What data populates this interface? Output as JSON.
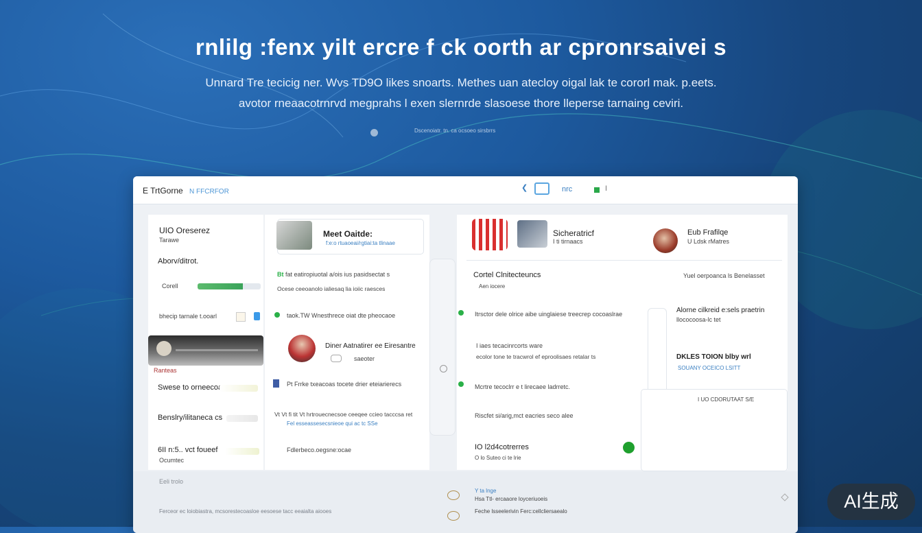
{
  "hero": {
    "title": "rnlilg :fenx yilt ercre f ck oorth ar cpronrsaivei s",
    "subtitle_line1": "Unnard  Tre tecicig ner. Wvs TD9O likes snoarts. Methes uan atecloy oigal lak te cororl mak. p.eets.",
    "subtitle_line2": "avotor rneaacotrnrvd megprahs l exen slernrde slasoese thore lleperse tarnaing ceviri.",
    "caption": "Dscenoiatr. tn. ca ocsoeo sirsbrrs"
  },
  "window": {
    "brand": "E TrtGorne",
    "brand_accent": "N  FFCRFOR",
    "toolbar_label": "nrc",
    "toolbar_marker": "I"
  },
  "left_column": {
    "header": "UIO Oreserez",
    "header_sub": "Tarawe",
    "section_label": "Aborv/ditrot.",
    "progress_label": "Corell",
    "progress_value": 0.72,
    "item1": "bhecip  tarnale  t.ooarl",
    "image_caption": "Ranteas",
    "item2": "Swese to orneecoa",
    "item3": "Benslry/ilitaneca cs",
    "item4_title": "6II n:5..  vct foueef",
    "item4_sub": "Ocumtec"
  },
  "mid_column": {
    "card_title": "Meet Oaitde:",
    "card_sub": "f:e:o rtuaoeai/rgtiai:ta tlinaae",
    "row1_strong": "Bt",
    "row1": "fat eatiropiuotal a/ois ius pasidsectat s",
    "row1_sub": "Ocese ceeoanolo ialiesaq lia ioiic raesces",
    "row2": "taok.TW Wnesthrece oiat dte pheocaoe",
    "person_name": "Diner Aatnatirer ee Eiresantre",
    "person_role": "saeoter",
    "row3": "Pt Frrke  txeacoas  tocete  drier eteiarierecs",
    "row4": "Vt Vt fi tit Vt hrtrouecnecsoe ceeqee ccieo tacccsa ret",
    "row4_sub": "Fel esseassesecsnieoe  qui ac tc  SSe",
    "row5": "Fdlerbeco.oegsne:ocae"
  },
  "right_column": {
    "profile1_name": "Sicheratricf",
    "profile1_sub": "I ti tirnaacs",
    "profile2_name": "Eub Frafilqe",
    "profile2_sub": "U Ldsk rMatres",
    "section_title": "Cortel Clnitecteuncs",
    "section_sub": "Aen iocere",
    "section_right": "Yuel oerpoanca ls Benelasset",
    "row1": "Itrsctor dele olrice aibe uinglaiese treecrep cocoaslrae",
    "row2_title": "I iaes tecacinrcorts ware",
    "row2_sub": "ecolor tone te tracwrol ef eproolisaes retalar ts",
    "row3": "Mcrtre tecoclrr e t lirecaee ladrretc.",
    "row4": "Riscfet si/arig,mct eacries seco alee",
    "row5_title": "IO l2d4cotrerres",
    "row5_sub": "O lo  Suteo ci te lrie",
    "side1_title": "Alorne cilkreid e:sels praetrin",
    "side1_sub": "llococoosa-lc tet",
    "side2_title": "DKLES TOION blby wrl",
    "side2_sub": "SOUANY  OCEICO LSITT",
    "side3": "I UO  CDORUTAAT S/E"
  },
  "footer": {
    "left_label": "Eeli trolo",
    "left_text": "Ferceor ec loiobiastra, mcsorestecoasloe eesoese tacc eeaialta aiooes",
    "right_title": "Y ta lnge",
    "right_sub": "Hsa Ttl- ercaaore loyceriuoeis",
    "right_text": "Feche lsseelerivin  Ferc:cellcliersaealo"
  },
  "badge": {
    "label": "AI生成"
  }
}
